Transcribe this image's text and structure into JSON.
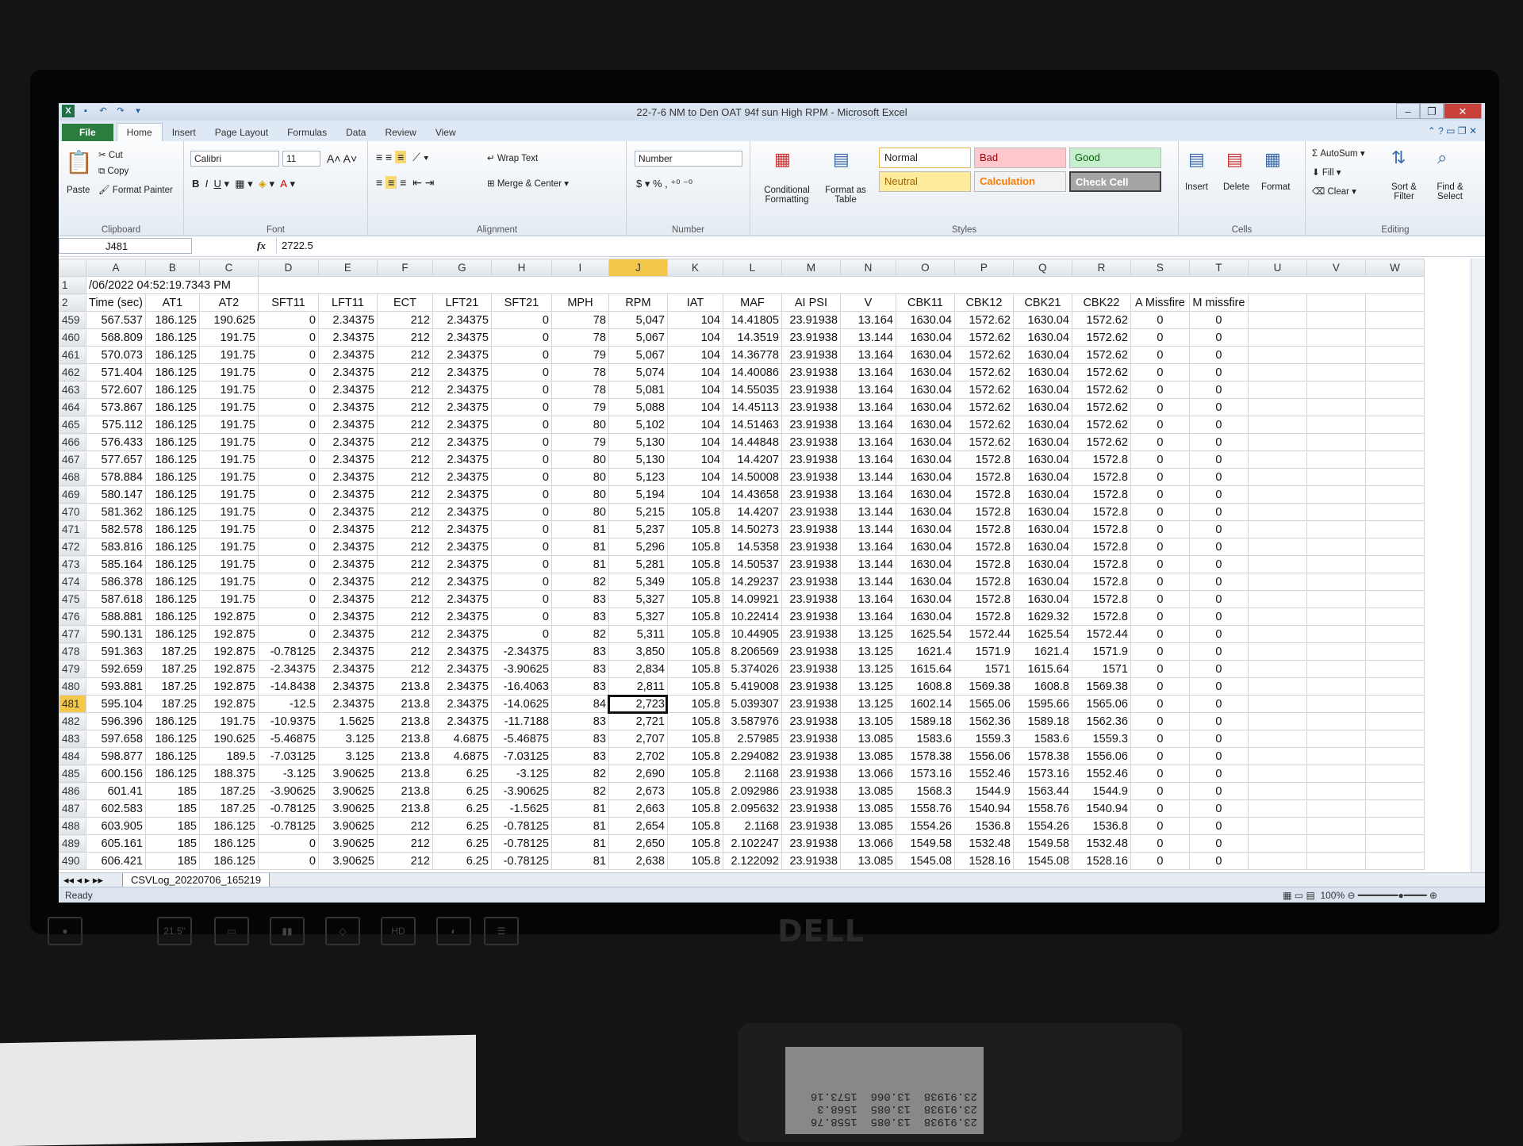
{
  "window": {
    "title": "22-7-6 NM to Den OAT 94f sun High RPM - Microsoft Excel"
  },
  "tabs": [
    "Home",
    "Insert",
    "Page Layout",
    "Formulas",
    "Data",
    "Review",
    "View"
  ],
  "file_tab": "File",
  "ribbon": {
    "clipboard": {
      "paste": "Paste",
      "cut": "Cut",
      "copy": "Copy",
      "format_painter": "Format Painter",
      "label": "Clipboard"
    },
    "font": {
      "name": "Calibri",
      "size": "11",
      "label": "Font"
    },
    "alignment": {
      "wrap": "Wrap Text",
      "merge": "Merge & Center",
      "label": "Alignment"
    },
    "number": {
      "format": "Number",
      "label": "Number"
    },
    "styles": {
      "cond": "Conditional Formatting",
      "table": "Format as Table",
      "normal": "Normal",
      "bad": "Bad",
      "good": "Good",
      "neutral": "Neutral",
      "calculation": "Calculation",
      "check": "Check Cell",
      "label": "Styles"
    },
    "cells": {
      "insert": "Insert",
      "delete": "Delete",
      "format": "Format",
      "label": "Cells"
    },
    "editing": {
      "autosum": "AutoSum",
      "fill": "Fill",
      "clear": "Clear",
      "sort": "Sort & Filter",
      "find": "Find & Select",
      "label": "Editing"
    }
  },
  "formula_bar": {
    "cell": "J481",
    "fx": "fx",
    "value": "2722.5"
  },
  "columns": [
    "A",
    "B",
    "C",
    "D",
    "E",
    "F",
    "G",
    "H",
    "I",
    "J",
    "K",
    "L",
    "M",
    "N",
    "O",
    "P",
    "Q",
    "R",
    "S",
    "T",
    "U",
    "V",
    "W"
  ],
  "row1": {
    "num": "1",
    "a": "/06/2022 04:52:19.7343 PM"
  },
  "headers": {
    "num": "2",
    "cells": [
      "Time (sec)",
      "AT1",
      "AT2",
      "SFT11",
      "LFT11",
      "ECT",
      "LFT21",
      "SFT21",
      "MPH",
      "RPM",
      "IAT",
      "MAF",
      "AI PSI",
      "V",
      "CBK11",
      "CBK12",
      "CBK21",
      "CBK22",
      "A Missfire",
      "M missfire"
    ]
  },
  "rows": [
    [
      "459",
      "567.537",
      "186.125",
      "190.625",
      "0",
      "2.34375",
      "212",
      "2.34375",
      "0",
      "78",
      "5,047",
      "104",
      "14.41805",
      "23.91938",
      "13.164",
      "1630.04",
      "1572.62",
      "1630.04",
      "1572.62",
      "0",
      "0"
    ],
    [
      "460",
      "568.809",
      "186.125",
      "191.75",
      "0",
      "2.34375",
      "212",
      "2.34375",
      "0",
      "78",
      "5,067",
      "104",
      "14.3519",
      "23.91938",
      "13.144",
      "1630.04",
      "1572.62",
      "1630.04",
      "1572.62",
      "0",
      "0"
    ],
    [
      "461",
      "570.073",
      "186.125",
      "191.75",
      "0",
      "2.34375",
      "212",
      "2.34375",
      "0",
      "79",
      "5,067",
      "104",
      "14.36778",
      "23.91938",
      "13.164",
      "1630.04",
      "1572.62",
      "1630.04",
      "1572.62",
      "0",
      "0"
    ],
    [
      "462",
      "571.404",
      "186.125",
      "191.75",
      "0",
      "2.34375",
      "212",
      "2.34375",
      "0",
      "78",
      "5,074",
      "104",
      "14.40086",
      "23.91938",
      "13.164",
      "1630.04",
      "1572.62",
      "1630.04",
      "1572.62",
      "0",
      "0"
    ],
    [
      "463",
      "572.607",
      "186.125",
      "191.75",
      "0",
      "2.34375",
      "212",
      "2.34375",
      "0",
      "78",
      "5,081",
      "104",
      "14.55035",
      "23.91938",
      "13.164",
      "1630.04",
      "1572.62",
      "1630.04",
      "1572.62",
      "0",
      "0"
    ],
    [
      "464",
      "573.867",
      "186.125",
      "191.75",
      "0",
      "2.34375",
      "212",
      "2.34375",
      "0",
      "79",
      "5,088",
      "104",
      "14.45113",
      "23.91938",
      "13.164",
      "1630.04",
      "1572.62",
      "1630.04",
      "1572.62",
      "0",
      "0"
    ],
    [
      "465",
      "575.112",
      "186.125",
      "191.75",
      "0",
      "2.34375",
      "212",
      "2.34375",
      "0",
      "80",
      "5,102",
      "104",
      "14.51463",
      "23.91938",
      "13.164",
      "1630.04",
      "1572.62",
      "1630.04",
      "1572.62",
      "0",
      "0"
    ],
    [
      "466",
      "576.433",
      "186.125",
      "191.75",
      "0",
      "2.34375",
      "212",
      "2.34375",
      "0",
      "79",
      "5,130",
      "104",
      "14.44848",
      "23.91938",
      "13.164",
      "1630.04",
      "1572.62",
      "1630.04",
      "1572.62",
      "0",
      "0"
    ],
    [
      "467",
      "577.657",
      "186.125",
      "191.75",
      "0",
      "2.34375",
      "212",
      "2.34375",
      "0",
      "80",
      "5,130",
      "104",
      "14.4207",
      "23.91938",
      "13.164",
      "1630.04",
      "1572.8",
      "1630.04",
      "1572.8",
      "0",
      "0"
    ],
    [
      "468",
      "578.884",
      "186.125",
      "191.75",
      "0",
      "2.34375",
      "212",
      "2.34375",
      "0",
      "80",
      "5,123",
      "104",
      "14.50008",
      "23.91938",
      "13.144",
      "1630.04",
      "1572.8",
      "1630.04",
      "1572.8",
      "0",
      "0"
    ],
    [
      "469",
      "580.147",
      "186.125",
      "191.75",
      "0",
      "2.34375",
      "212",
      "2.34375",
      "0",
      "80",
      "5,194",
      "104",
      "14.43658",
      "23.91938",
      "13.164",
      "1630.04",
      "1572.8",
      "1630.04",
      "1572.8",
      "0",
      "0"
    ],
    [
      "470",
      "581.362",
      "186.125",
      "191.75",
      "0",
      "2.34375",
      "212",
      "2.34375",
      "0",
      "80",
      "5,215",
      "105.8",
      "14.4207",
      "23.91938",
      "13.144",
      "1630.04",
      "1572.8",
      "1630.04",
      "1572.8",
      "0",
      "0"
    ],
    [
      "471",
      "582.578",
      "186.125",
      "191.75",
      "0",
      "2.34375",
      "212",
      "2.34375",
      "0",
      "81",
      "5,237",
      "105.8",
      "14.50273",
      "23.91938",
      "13.144",
      "1630.04",
      "1572.8",
      "1630.04",
      "1572.8",
      "0",
      "0"
    ],
    [
      "472",
      "583.816",
      "186.125",
      "191.75",
      "0",
      "2.34375",
      "212",
      "2.34375",
      "0",
      "81",
      "5,296",
      "105.8",
      "14.5358",
      "23.91938",
      "13.164",
      "1630.04",
      "1572.8",
      "1630.04",
      "1572.8",
      "0",
      "0"
    ],
    [
      "473",
      "585.164",
      "186.125",
      "191.75",
      "0",
      "2.34375",
      "212",
      "2.34375",
      "0",
      "81",
      "5,281",
      "105.8",
      "14.50537",
      "23.91938",
      "13.144",
      "1630.04",
      "1572.8",
      "1630.04",
      "1572.8",
      "0",
      "0"
    ],
    [
      "474",
      "586.378",
      "186.125",
      "191.75",
      "0",
      "2.34375",
      "212",
      "2.34375",
      "0",
      "82",
      "5,349",
      "105.8",
      "14.29237",
      "23.91938",
      "13.144",
      "1630.04",
      "1572.8",
      "1630.04",
      "1572.8",
      "0",
      "0"
    ],
    [
      "475",
      "587.618",
      "186.125",
      "191.75",
      "0",
      "2.34375",
      "212",
      "2.34375",
      "0",
      "83",
      "5,327",
      "105.8",
      "14.09921",
      "23.91938",
      "13.164",
      "1630.04",
      "1572.8",
      "1630.04",
      "1572.8",
      "0",
      "0"
    ],
    [
      "476",
      "588.881",
      "186.125",
      "192.875",
      "0",
      "2.34375",
      "212",
      "2.34375",
      "0",
      "83",
      "5,327",
      "105.8",
      "10.22414",
      "23.91938",
      "13.164",
      "1630.04",
      "1572.8",
      "1629.32",
      "1572.8",
      "0",
      "0"
    ],
    [
      "477",
      "590.131",
      "186.125",
      "192.875",
      "0",
      "2.34375",
      "212",
      "2.34375",
      "0",
      "82",
      "5,311",
      "105.8",
      "10.44905",
      "23.91938",
      "13.125",
      "1625.54",
      "1572.44",
      "1625.54",
      "1572.44",
      "0",
      "0"
    ],
    [
      "478",
      "591.363",
      "187.25",
      "192.875",
      "-0.78125",
      "2.34375",
      "212",
      "2.34375",
      "-2.34375",
      "83",
      "3,850",
      "105.8",
      "8.206569",
      "23.91938",
      "13.125",
      "1621.4",
      "1571.9",
      "1621.4",
      "1571.9",
      "0",
      "0"
    ],
    [
      "479",
      "592.659",
      "187.25",
      "192.875",
      "-2.34375",
      "2.34375",
      "212",
      "2.34375",
      "-3.90625",
      "83",
      "2,834",
      "105.8",
      "5.374026",
      "23.91938",
      "13.125",
      "1615.64",
      "1571",
      "1615.64",
      "1571",
      "0",
      "0"
    ],
    [
      "480",
      "593.881",
      "187.25",
      "192.875",
      "-14.8438",
      "2.34375",
      "213.8",
      "2.34375",
      "-16.4063",
      "83",
      "2,811",
      "105.8",
      "5.419008",
      "23.91938",
      "13.125",
      "1608.8",
      "1569.38",
      "1608.8",
      "1569.38",
      "0",
      "0"
    ],
    [
      "481",
      "595.104",
      "187.25",
      "192.875",
      "-12.5",
      "2.34375",
      "213.8",
      "2.34375",
      "-14.0625",
      "84",
      "2,723",
      "105.8",
      "5.039307",
      "23.91938",
      "13.125",
      "1602.14",
      "1565.06",
      "1595.66",
      "1565.06",
      "0",
      "0"
    ],
    [
      "482",
      "596.396",
      "186.125",
      "191.75",
      "-10.9375",
      "1.5625",
      "213.8",
      "2.34375",
      "-11.7188",
      "83",
      "2,721",
      "105.8",
      "3.587976",
      "23.91938",
      "13.105",
      "1589.18",
      "1562.36",
      "1589.18",
      "1562.36",
      "0",
      "0"
    ],
    [
      "483",
      "597.658",
      "186.125",
      "190.625",
      "-5.46875",
      "3.125",
      "213.8",
      "4.6875",
      "-5.46875",
      "83",
      "2,707",
      "105.8",
      "2.57985",
      "23.91938",
      "13.085",
      "1583.6",
      "1559.3",
      "1583.6",
      "1559.3",
      "0",
      "0"
    ],
    [
      "484",
      "598.877",
      "186.125",
      "189.5",
      "-7.03125",
      "3.125",
      "213.8",
      "4.6875",
      "-7.03125",
      "83",
      "2,702",
      "105.8",
      "2.294082",
      "23.91938",
      "13.085",
      "1578.38",
      "1556.06",
      "1578.38",
      "1556.06",
      "0",
      "0"
    ],
    [
      "485",
      "600.156",
      "186.125",
      "188.375",
      "-3.125",
      "3.90625",
      "213.8",
      "6.25",
      "-3.125",
      "82",
      "2,690",
      "105.8",
      "2.1168",
      "23.91938",
      "13.066",
      "1573.16",
      "1552.46",
      "1573.16",
      "1552.46",
      "0",
      "0"
    ],
    [
      "486",
      "601.41",
      "185",
      "187.25",
      "-3.90625",
      "3.90625",
      "213.8",
      "6.25",
      "-3.90625",
      "82",
      "2,673",
      "105.8",
      "2.092986",
      "23.91938",
      "13.085",
      "1568.3",
      "1544.9",
      "1563.44",
      "1544.9",
      "0",
      "0"
    ],
    [
      "487",
      "602.583",
      "185",
      "187.25",
      "-0.78125",
      "3.90625",
      "213.8",
      "6.25",
      "-1.5625",
      "81",
      "2,663",
      "105.8",
      "2.095632",
      "23.91938",
      "13.085",
      "1558.76",
      "1540.94",
      "1558.76",
      "1540.94",
      "0",
      "0"
    ],
    [
      "488",
      "603.905",
      "185",
      "186.125",
      "-0.78125",
      "3.90625",
      "212",
      "6.25",
      "-0.78125",
      "81",
      "2,654",
      "105.8",
      "2.1168",
      "23.91938",
      "13.085",
      "1554.26",
      "1536.8",
      "1554.26",
      "1536.8",
      "0",
      "0"
    ],
    [
      "489",
      "605.161",
      "185",
      "186.125",
      "0",
      "3.90625",
      "212",
      "6.25",
      "-0.78125",
      "81",
      "2,650",
      "105.8",
      "2.102247",
      "23.91938",
      "13.066",
      "1549.58",
      "1532.48",
      "1549.58",
      "1532.48",
      "0",
      "0"
    ],
    [
      "490",
      "606.421",
      "185",
      "186.125",
      "0",
      "3.90625",
      "212",
      "6.25",
      "-0.78125",
      "81",
      "2,638",
      "105.8",
      "2.122092",
      "23.91938",
      "13.085",
      "1545.08",
      "1528.16",
      "1545.08",
      "1528.16",
      "0",
      "0"
    ]
  ],
  "sheet_tab": "CSVLog_20220706_165219",
  "status": {
    "ready": "Ready",
    "zoom": "100%"
  },
  "monitor": {
    "brand": "DELL",
    "size": "21.5\"",
    "hd": "HD"
  },
  "device_readout": "23.91938  13.085  1558.76\n23.91938  13.085  1568.3\n23.91938  13.066  1573.16"
}
